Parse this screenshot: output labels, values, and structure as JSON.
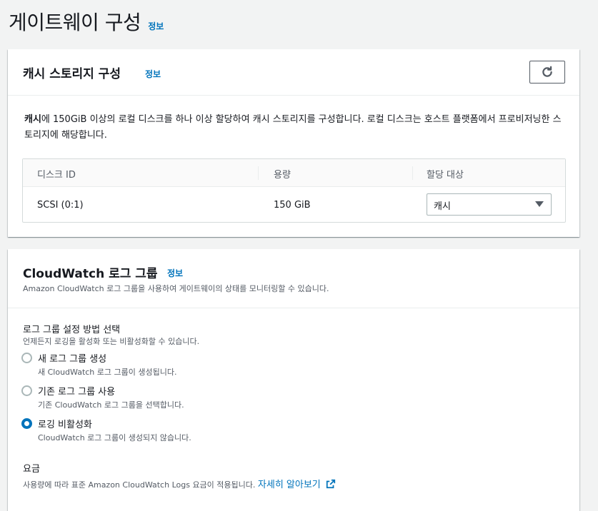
{
  "page": {
    "title": "게이트웨이 구성",
    "info_label": "정보"
  },
  "cache_panel": {
    "title": "캐시 스토리지 구성",
    "info_label": "정보",
    "refresh_icon": "refresh-icon",
    "description_bold": "캐시",
    "description_rest": "에 150GiB 이상의 로컬 디스크를 하나 이상 할당하여 캐시 스토리지를 구성합니다. 로컬 디스크는 호스트 플랫폼에서 프로비저닝한 스토리지에 해당합니다.",
    "table": {
      "columns": [
        "디스크 ID",
        "용량",
        "할당 대상"
      ],
      "rows": [
        {
          "disk_id": "SCSI (0:1)",
          "capacity": "150 GiB",
          "allocation": "캐시"
        }
      ]
    }
  },
  "cloudwatch_panel": {
    "title": "CloudWatch 로그 그룹",
    "info_label": "정보",
    "description": "Amazon CloudWatch 로그 그룹을 사용하여 게이트웨이의 상태를 모니터링할 수 있습니다.",
    "method_label": "로그 그룹 설정 방법 선택",
    "method_desc": "언제든지 로깅을 활성화 또는 비활성화할 수 있습니다.",
    "options": [
      {
        "label": "새 로그 그룹 생성",
        "desc": "새 CloudWatch 로그 그룹이 생성됩니다.",
        "checked": false
      },
      {
        "label": "기존 로그 그룹 사용",
        "desc": "기존 CloudWatch 로그 그룹을 선택합니다.",
        "checked": false
      },
      {
        "label": "로깅 비활성화",
        "desc": "CloudWatch 로그 그룹이 생성되지 않습니다.",
        "checked": true
      }
    ],
    "fee_label": "요금",
    "fee_desc": "사용량에 따라 표준 Amazon CloudWatch Logs 요금이 적용됩니다.",
    "fee_link": "자세히 알아보기",
    "external_icon": "external-link-icon"
  },
  "colors": {
    "link": "#0073bb",
    "background": "#f2f3f3"
  }
}
